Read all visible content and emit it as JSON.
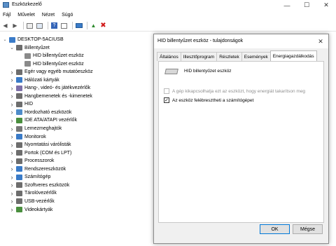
{
  "window": {
    "title": "Eszközkezelő"
  },
  "menu": [
    "Fájl",
    "Művelet",
    "Nézet",
    "Súgó"
  ],
  "tree": {
    "root": "DESKTOP-5ACIUSB",
    "items": [
      {
        "label": "Billentyűzet",
        "level": 1,
        "expanded": true,
        "icon_color": "#6d6d6d"
      },
      {
        "label": "HID billentyűzet eszköz",
        "level": 2,
        "icon_color": "#8a8a8a"
      },
      {
        "label": "HID billentyűzet eszköz",
        "level": 2,
        "icon_color": "#8a8a8a"
      },
      {
        "label": "Egér vagy egyéb mutatóeszköz",
        "level": 1,
        "icon_color": "#6d6d6d"
      },
      {
        "label": "Hálózati kártyák",
        "level": 1,
        "icon_color": "#3a7bc8"
      },
      {
        "label": "Hang-, videó- és játékvezérlők",
        "level": 1,
        "icon_color": "#7d6fa8"
      },
      {
        "label": "Hangbemenetek és -kimenetek",
        "level": 1,
        "icon_color": "#6d6d6d"
      },
      {
        "label": "HID",
        "level": 1,
        "icon_color": "#6d6d6d"
      },
      {
        "label": "Hordozható eszközök",
        "level": 1,
        "icon_color": "#4e8cc9"
      },
      {
        "label": "IDE ATA/ATAPI vezérlők",
        "level": 1,
        "icon_color": "#4a8f3e"
      },
      {
        "label": "Lemezmeghajtók",
        "level": 1,
        "icon_color": "#777777"
      },
      {
        "label": "Monitorok",
        "level": 1,
        "icon_color": "#3a7bc8"
      },
      {
        "label": "Nyomtatási várólisták",
        "level": 1,
        "icon_color": "#6d6d6d"
      },
      {
        "label": "Portok (COM és LPT)",
        "level": 1,
        "icon_color": "#6d6d6d"
      },
      {
        "label": "Processzorok",
        "level": 1,
        "icon_color": "#6d6d6d"
      },
      {
        "label": "Rendszereszközök",
        "level": 1,
        "icon_color": "#3a7bc8"
      },
      {
        "label": "Számítógép",
        "level": 1,
        "icon_color": "#3a7bc8"
      },
      {
        "label": "Szoftveres eszközök",
        "level": 1,
        "icon_color": "#6d6d6d"
      },
      {
        "label": "Tárolóvezérlők",
        "level": 1,
        "icon_color": "#6d6d6d"
      },
      {
        "label": "USB-vezérlők",
        "level": 1,
        "icon_color": "#6d6d6d"
      },
      {
        "label": "Videokártyák",
        "level": 1,
        "icon_color": "#4a8f3e"
      }
    ]
  },
  "dialog": {
    "title": "HID billentyűzet eszköz - tulajdonságok",
    "tabs": [
      "Általános",
      "Illesztőprogram",
      "Részletek",
      "Események",
      "Energiagazdálkodás"
    ],
    "active_tab": 4,
    "device_name": "HID billentyűzet eszköz",
    "option_disabled": "A gép kikapcsolhatja ezt az eszközt, hogy energiát takarítson meg",
    "option_wake": "Az eszköz felébresztheti a számítógépet",
    "option_wake_checked": true,
    "ok_label": "OK",
    "cancel_label": "Mégse"
  },
  "colors": {
    "accent": "#0078d7"
  }
}
